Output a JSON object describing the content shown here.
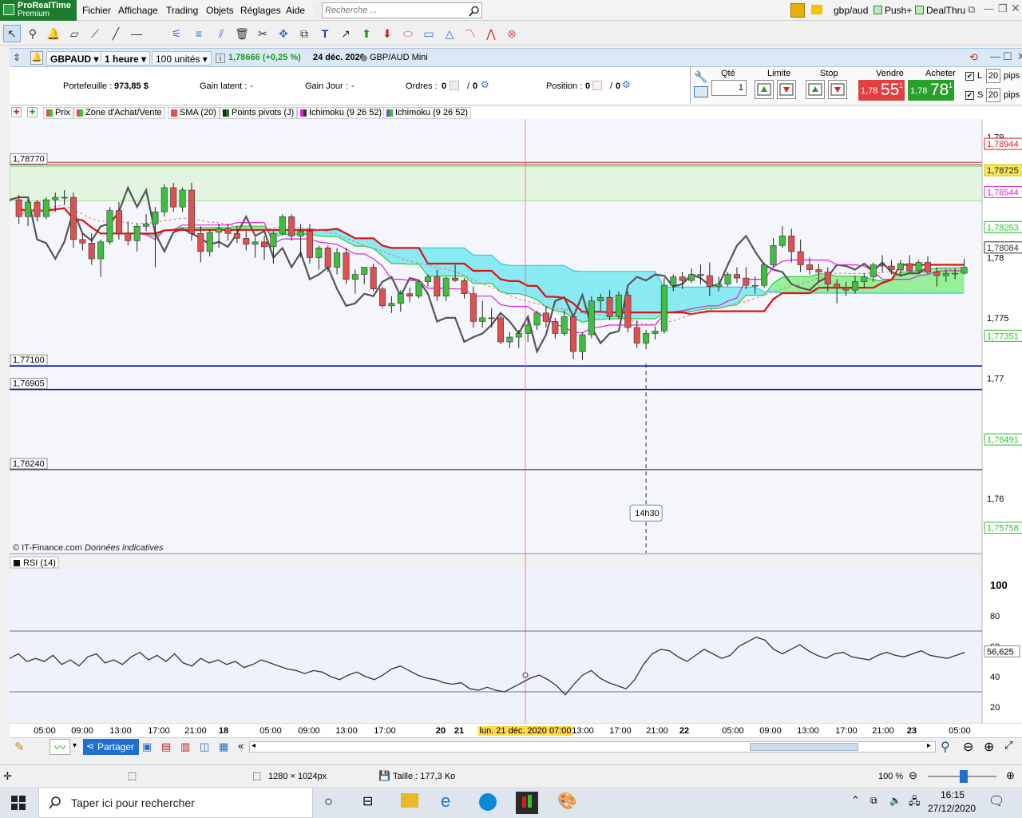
{
  "app": {
    "name": "ProRealTime",
    "edition": "Premium"
  },
  "menu": [
    "Fichier",
    "Affichage",
    "Trading",
    "Objets",
    "Réglages",
    "Aide"
  ],
  "search": {
    "placeholder": "Recherche ..."
  },
  "right_tabs": {
    "symbol": "gbp/aud",
    "push": "Push+",
    "dealthru": "DealThru"
  },
  "chart_header": {
    "symbol": "GBPAUD",
    "timeframe": "1 heure",
    "units": "100 unités",
    "price_info": "1,78666 (+0,25 %)",
    "date": "24 déc. 2020",
    "instrument": "GBP/AUD Mini"
  },
  "portfolio": {
    "portefeuille_label": "Portefeuille :",
    "portefeuille_value": "973,85 $",
    "gain_latent_label": "Gain latent :",
    "gain_latent_value": "-",
    "gain_jour_label": "Gain Jour :",
    "gain_jour_value": "-",
    "ordres_label": "Ordres :",
    "ordres_value_a": "0",
    "ordres_value_b": "0",
    "position_label": "Position :",
    "position_value_a": "0",
    "position_value_b": "0"
  },
  "order_panel": {
    "qte_label": "Qté",
    "qte_value": "1",
    "limite_label": "Limite",
    "stop_label": "Stop",
    "vendre_label": "Vendre",
    "vendre_small": "1,78",
    "vendre_big": "55",
    "vendre_sup": "1",
    "acheter_label": "Acheter",
    "acheter_small": "1,78",
    "acheter_big": "78",
    "acheter_sup": "1",
    "l_label": "L",
    "l_pips": "20",
    "s_label": "S",
    "s_pips": "20",
    "pips_label": "pips"
  },
  "legend": [
    "Prix",
    "Zone d'Achat/Vente",
    "SMA (20)",
    "Points pivots (J)",
    "Ichimoku (9 26 52)",
    "Ichimoku (9 26 52)"
  ],
  "colors": {
    "up": "#3fbf3f",
    "down": "#e05050",
    "sma": "#dd1111",
    "kijun": "#dd22dd",
    "chikou": "#555555",
    "cloud_up": "#77ee77",
    "cloud_down": "#66e6f0",
    "pivot": "#0a14b4"
  },
  "chart_data": [
    {
      "type": "candlestick",
      "instrument": "GBP/AUD Mini",
      "timeframe": "1 heure",
      "ylim": [
        1.7555,
        1.7915
      ],
      "y_ticks": [
        "1,79",
        "1,78",
        "1,775",
        "1,77",
        "1,76"
      ],
      "level_lines": [
        {
          "label": "1,78770",
          "value": 1.7877
        },
        {
          "label": "1,77100",
          "value": 1.771
        },
        {
          "label": "1,76905",
          "value": 1.76905
        },
        {
          "label": "1,76240",
          "value": 1.7624
        }
      ],
      "right_labels": [
        "1,78944",
        "1,78725",
        "1,78544",
        "1,78253",
        "1,78253",
        "1,78084",
        "1,77351",
        "1,76491",
        "1,75758"
      ],
      "current_price": 1.78666,
      "candles_ohlc": [
        [
          1.7848,
          1.7852,
          1.7828,
          1.7834
        ],
        [
          1.7834,
          1.7848,
          1.7826,
          1.7846
        ],
        [
          1.7846,
          1.7848,
          1.783,
          1.7834
        ],
        [
          1.7834,
          1.785,
          1.7832,
          1.7848
        ],
        [
          1.7848,
          1.7854,
          1.7838,
          1.785
        ],
        [
          1.785,
          1.7856,
          1.7844,
          1.785
        ],
        [
          1.785,
          1.7854,
          1.7808,
          1.7815
        ],
        [
          1.7815,
          1.782,
          1.7806,
          1.7812
        ],
        [
          1.7812,
          1.782,
          1.7794,
          1.7799
        ],
        [
          1.7799,
          1.7815,
          1.7784,
          1.7813
        ],
        [
          1.7813,
          1.7842,
          1.7811,
          1.7839
        ],
        [
          1.7839,
          1.7846,
          1.7815,
          1.782
        ],
        [
          1.782,
          1.783,
          1.781,
          1.7814
        ],
        [
          1.7814,
          1.7828,
          1.7805,
          1.7826
        ],
        [
          1.7826,
          1.7836,
          1.7822,
          1.7828
        ],
        [
          1.7828,
          1.7842,
          1.7792,
          1.7838
        ],
        [
          1.7838,
          1.7861,
          1.7834,
          1.7858
        ],
        [
          1.7858,
          1.7862,
          1.7838,
          1.7842
        ],
        [
          1.7842,
          1.7858,
          1.7838,
          1.7856
        ],
        [
          1.7856,
          1.7862,
          1.7814,
          1.782
        ],
        [
          1.782,
          1.7826,
          1.7796,
          1.7805
        ],
        [
          1.7805,
          1.7823,
          1.7801,
          1.7821
        ],
        [
          1.7821,
          1.7828,
          1.7808,
          1.7824
        ],
        [
          1.7824,
          1.7828,
          1.7814,
          1.782
        ],
        [
          1.782,
          1.7826,
          1.7812,
          1.7816
        ],
        [
          1.7816,
          1.7822,
          1.7806,
          1.7811
        ],
        [
          1.7811,
          1.7817,
          1.78,
          1.7813
        ],
        [
          1.7813,
          1.7818,
          1.7798,
          1.7809
        ],
        [
          1.7809,
          1.7822,
          1.7795,
          1.782
        ],
        [
          1.782,
          1.7836,
          1.7818,
          1.7834
        ],
        [
          1.7834,
          1.7836,
          1.7814,
          1.7818
        ],
        [
          1.7818,
          1.7828,
          1.78,
          1.7822
        ],
        [
          1.7822,
          1.7828,
          1.7795,
          1.78
        ],
        [
          1.78,
          1.781,
          1.779,
          1.7808
        ],
        [
          1.7808,
          1.781,
          1.7788,
          1.7792
        ],
        [
          1.7792,
          1.7808,
          1.7786,
          1.7804
        ],
        [
          1.7804,
          1.7808,
          1.7778,
          1.7782
        ],
        [
          1.7782,
          1.779,
          1.777,
          1.7786
        ],
        [
          1.7786,
          1.7792,
          1.7778,
          1.7792
        ],
        [
          1.7792,
          1.7795,
          1.7772,
          1.7774
        ],
        [
          1.7774,
          1.7776,
          1.7758,
          1.776
        ],
        [
          1.776,
          1.7768,
          1.7754,
          1.7762
        ],
        [
          1.7762,
          1.7773,
          1.7755,
          1.777
        ],
        [
          1.777,
          1.7775,
          1.7763,
          1.7768
        ],
        [
          1.7768,
          1.7782,
          1.7766,
          1.778
        ],
        [
          1.778,
          1.7786,
          1.7776,
          1.7784
        ],
        [
          1.7784,
          1.779,
          1.7764,
          1.7768
        ],
        [
          1.7768,
          1.7784,
          1.7764,
          1.7783
        ],
        [
          1.7783,
          1.7794,
          1.778,
          1.7781
        ],
        [
          1.7781,
          1.7783,
          1.7766,
          1.777
        ],
        [
          1.777,
          1.7776,
          1.7742,
          1.7747
        ],
        [
          1.7747,
          1.7764,
          1.7742,
          1.775
        ],
        [
          1.775,
          1.7758,
          1.7742,
          1.775
        ],
        [
          1.775,
          1.7752,
          1.7728,
          1.773
        ],
        [
          1.773,
          1.7738,
          1.7725,
          1.7734
        ],
        [
          1.7734,
          1.774,
          1.7725,
          1.7737
        ],
        [
          1.7737,
          1.7749,
          1.773,
          1.7744
        ],
        [
          1.7744,
          1.7756,
          1.774,
          1.7754
        ],
        [
          1.7754,
          1.776,
          1.7742,
          1.7747
        ],
        [
          1.7747,
          1.775,
          1.7733,
          1.7737
        ],
        [
          1.7737,
          1.7756,
          1.7735,
          1.7751
        ],
        [
          1.7751,
          1.7752,
          1.7716,
          1.7722
        ],
        [
          1.7722,
          1.7738,
          1.7715,
          1.7736
        ],
        [
          1.7736,
          1.7768,
          1.7733,
          1.7764
        ],
        [
          1.7764,
          1.777,
          1.7756,
          1.7767
        ],
        [
          1.7767,
          1.7773,
          1.7748,
          1.7751
        ],
        [
          1.7751,
          1.7772,
          1.7749,
          1.7769
        ],
        [
          1.7769,
          1.7772,
          1.7738,
          1.7742
        ],
        [
          1.7742,
          1.7748,
          1.7725,
          1.7729
        ],
        [
          1.7729,
          1.774,
          1.7724,
          1.7737
        ],
        [
          1.7737,
          1.7743,
          1.7732,
          1.7739
        ],
        [
          1.7739,
          1.7783,
          1.7737,
          1.7777
        ],
        [
          1.7777,
          1.7786,
          1.7772,
          1.7784
        ],
        [
          1.7784,
          1.7788,
          1.7774,
          1.7781
        ],
        [
          1.7781,
          1.7791,
          1.7779,
          1.7786
        ],
        [
          1.7786,
          1.7794,
          1.7778,
          1.7785
        ],
        [
          1.7785,
          1.7796,
          1.7768,
          1.7776
        ],
        [
          1.7776,
          1.7784,
          1.7772,
          1.7778
        ],
        [
          1.7778,
          1.7788,
          1.7776,
          1.7786
        ],
        [
          1.7786,
          1.7792,
          1.7779,
          1.7783
        ],
        [
          1.7783,
          1.7792,
          1.7774,
          1.7777
        ],
        [
          1.7777,
          1.7784,
          1.777,
          1.7777
        ],
        [
          1.7777,
          1.7796,
          1.7775,
          1.7794
        ],
        [
          1.7794,
          1.7816,
          1.7792,
          1.781
        ],
        [
          1.781,
          1.7826,
          1.7808,
          1.7818
        ],
        [
          1.7818,
          1.7824,
          1.7796,
          1.7805
        ],
        [
          1.7805,
          1.7815,
          1.7788,
          1.7794
        ],
        [
          1.7794,
          1.78,
          1.7786,
          1.779
        ],
        [
          1.779,
          1.7795,
          1.778,
          1.7788
        ],
        [
          1.7788,
          1.7792,
          1.7772,
          1.7778
        ],
        [
          1.7778,
          1.7782,
          1.7762,
          1.7775
        ],
        [
          1.7775,
          1.778,
          1.7768,
          1.7773
        ],
        [
          1.7773,
          1.7785,
          1.777,
          1.778
        ],
        [
          1.778,
          1.7787,
          1.7775,
          1.7784
        ],
        [
          1.7784,
          1.7796,
          1.778,
          1.7794
        ],
        [
          1.7794,
          1.7802,
          1.7788,
          1.7793
        ],
        [
          1.7793,
          1.7798,
          1.7786,
          1.779
        ],
        [
          1.779,
          1.7798,
          1.7785,
          1.7795
        ],
        [
          1.7795,
          1.7802,
          1.7788,
          1.7789
        ],
        [
          1.7789,
          1.7798,
          1.7787,
          1.7796
        ],
        [
          1.7796,
          1.7801,
          1.7786,
          1.7788
        ],
        [
          1.7788,
          1.7792,
          1.7776,
          1.7785
        ],
        [
          1.7785,
          1.779,
          1.778,
          1.7787
        ],
        [
          1.7787,
          1.7791,
          1.7782,
          1.7787
        ],
        [
          1.7787,
          1.7799,
          1.7786,
          1.7792
        ]
      ],
      "tooltip": "14h30"
    },
    {
      "type": "line",
      "title": "RSI (14)",
      "ylim": [
        10,
        110
      ],
      "y_ticks": [
        "100",
        "80",
        "60",
        "40",
        "20"
      ],
      "levels": [
        70,
        30
      ],
      "last_value": "56,625",
      "values": [
        52,
        55,
        50,
        52,
        50,
        54,
        48,
        51,
        47,
        53,
        55,
        49,
        51,
        48,
        53,
        56,
        51,
        54,
        50,
        55,
        49,
        47,
        52,
        49,
        51,
        48,
        50,
        46,
        48,
        51,
        49,
        47,
        45,
        44,
        42,
        44,
        43,
        40,
        38,
        41,
        43,
        40,
        38,
        41,
        45,
        47,
        44,
        41,
        39,
        38,
        36,
        35,
        36,
        32,
        31,
        33,
        31,
        30,
        33,
        36,
        39,
        41,
        38,
        34,
        28,
        35,
        41,
        44,
        39,
        36,
        34,
        32,
        38,
        48,
        55,
        58,
        57,
        53,
        50,
        54,
        58,
        55,
        52,
        54,
        60,
        63,
        66,
        64,
        58,
        55,
        58,
        61,
        57,
        54,
        52,
        55,
        56,
        53,
        52,
        51,
        54,
        56,
        54,
        53,
        55,
        57,
        54,
        53,
        52,
        54,
        56
      ]
    }
  ],
  "x_axis": [
    {
      "t": "05:00"
    },
    {
      "t": "09:00"
    },
    {
      "t": "13:00"
    },
    {
      "t": "17:00"
    },
    {
      "t": "21:00"
    },
    {
      "t": "18",
      "bold": true
    },
    {
      "t": "05:00"
    },
    {
      "t": "09:00"
    },
    {
      "t": "13:00"
    },
    {
      "t": "17:00"
    },
    {
      "t": "20",
      "bold": true
    },
    {
      "t": "21",
      "bold": true
    },
    {
      "t": "lun. 21 déc. 2020 07:00",
      "cursor": true
    },
    {
      "t": "13:00"
    },
    {
      "t": "17:00"
    },
    {
      "t": "21:00"
    },
    {
      "t": "22",
      "bold": true
    },
    {
      "t": "05:00"
    },
    {
      "t": "09:00"
    },
    {
      "t": "13:00"
    },
    {
      "t": "17:00"
    },
    {
      "t": "21:00"
    },
    {
      "t": "23",
      "bold": true
    },
    {
      "t": "05:00"
    }
  ],
  "footer_note": "© IT-Finance.com",
  "footer_note_italic": "Données indicatives",
  "bottombar": {
    "share": "Partager"
  },
  "statusbar": {
    "dimensions": "1280 × 1024px",
    "size": "Taille : 177,3 Ko",
    "zoom": "100 %"
  },
  "taskbar": {
    "search_placeholder": "Taper ici pour rechercher",
    "time": "16:15",
    "date": "27/12/2020"
  }
}
